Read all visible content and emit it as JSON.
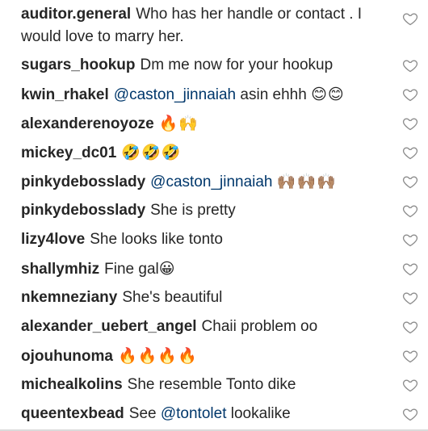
{
  "comments": [
    {
      "user": "auditor.general",
      "text": "Who has her handle or contact . I would love to marry her.",
      "mention": "",
      "emoji": ""
    },
    {
      "user": "sugars_hookup",
      "text": "Dm me now for your hookup",
      "mention": "",
      "emoji": ""
    },
    {
      "user": "kwin_rhakel",
      "text": "asin ehhh",
      "mention": "@caston_jinnaiah",
      "emoji": "😊😊"
    },
    {
      "user": "alexanderenoyoze",
      "text": "",
      "mention": "",
      "emoji": "🔥🙌"
    },
    {
      "user": "mickey_dc01",
      "text": "",
      "mention": "",
      "emoji": "🤣🤣🤣"
    },
    {
      "user": "pinkydebosslady",
      "text": "",
      "mention": "@caston_jinnaiah",
      "emoji": "🙌🏽🙌🏽🙌🏽"
    },
    {
      "user": "pinkydebosslady",
      "text": "She is pretty",
      "mention": "",
      "emoji": ""
    },
    {
      "user": "lizy4love",
      "text": "She looks like tonto",
      "mention": "",
      "emoji": ""
    },
    {
      "user": "shallymhiz",
      "text": "Fine gal",
      "mention": "",
      "emoji": "😀"
    },
    {
      "user": "nkemneziany",
      "text": "She's beautiful",
      "mention": "",
      "emoji": ""
    },
    {
      "user": "alexander_uebert_angel",
      "text": "Chaii problem oo",
      "mention": "",
      "emoji": ""
    },
    {
      "user": "ojouhunoma",
      "text": "",
      "mention": "",
      "emoji": "🔥🔥🔥🔥"
    },
    {
      "user": "michealkolins",
      "text": "She resemble Tonto dike",
      "mention": "",
      "emoji": ""
    },
    {
      "user": "queentexbead",
      "text": "lookalike",
      "prefix": "See",
      "mention": "@tontolet",
      "emoji": ""
    }
  ],
  "icons": {
    "like": "heart-outline-icon"
  },
  "colors": {
    "mention": "#00376b",
    "text": "#262626",
    "heart": "#8e8e8e"
  }
}
